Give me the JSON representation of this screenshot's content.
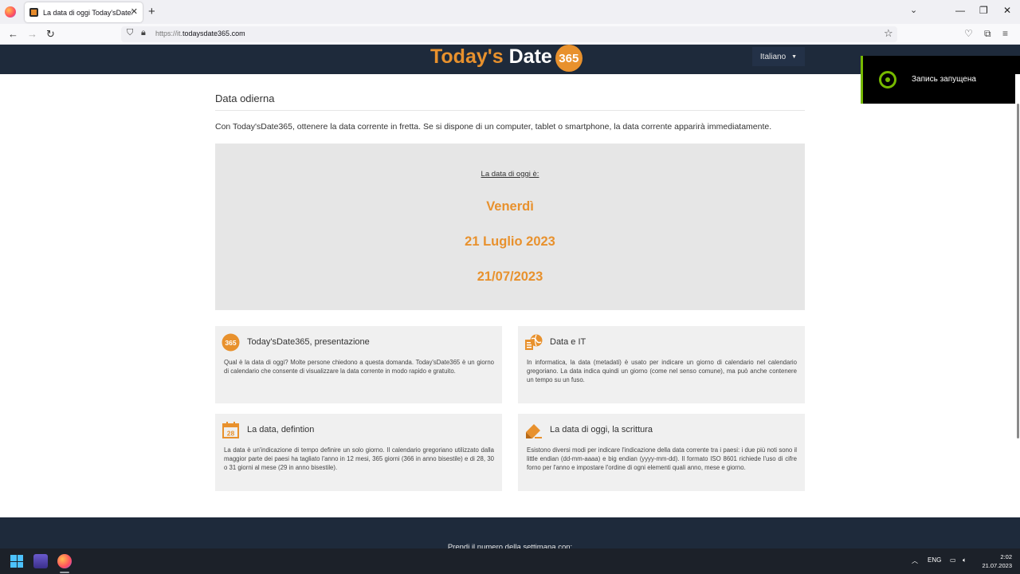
{
  "browser": {
    "tab_title": "La data di oggi Today'sDate365",
    "url_prefix": "https://it.",
    "url_domain": "todaysdate365.com"
  },
  "header": {
    "logo_today": "Today's",
    "logo_date": "Date",
    "logo_365": "365",
    "language": "Italiano"
  },
  "overlay": {
    "recording_text": "Запись запущена"
  },
  "main": {
    "title": "Data odierna",
    "intro": "Con Today'sDate365, ottenere la data corrente in fretta. Se si dispone di un computer, tablet o smartphone, la data corrente apparirà immediatamente.",
    "date_caption": "La data di oggi è:",
    "weekday": "Venerdì",
    "long_date": "21 Luglio 2023",
    "short_date": "21/07/2023"
  },
  "cards": [
    {
      "title": "Today'sDate365, presentazione",
      "icon_label": "365",
      "body": "Qual è la data di oggi? Molte persone chiedono a questa domanda. Today'sDate365 è un giorno di calendario che consente di visualizzare la data corrente in modo rapido e gratuito."
    },
    {
      "title": "Data e IT",
      "body": "In informatica, la data (metadati) è usato per indicare un giorno di calendario nel calendario gregoriano. La data indica quindi un giorno (come nel senso comune), ma può anche contenere un tempo su un fuso."
    },
    {
      "title": "La data, defintion",
      "icon_label": "28",
      "body": "La data è un'indicazione di tempo definire un solo giorno. Il calendario gregoriano utilizzato dalla maggior parte dei paesi ha tagliato l'anno in 12 mesi, 365 giorni (366 in anno bisestile) e di 28, 30 o 31 giorni al mese (29 in anno bisestile)."
    },
    {
      "title": "La data di oggi, la scrittura",
      "body": "Esistono diversi modi per indicare l'indicazione della data corrente tra i paesi: i due più noti sono il little endian (dd-mm-aaaa) e big endian (yyyy-mm-dd). Il formato ISO 8601 richiede l'uso di cifre forno per l'anno e impostare l'ordine di ogni elementi quali anno, mese e giorno."
    }
  ],
  "footer": {
    "text": "Prendi il numero della settimana con:"
  },
  "taskbar": {
    "language": "ENG",
    "time": "2:02",
    "date": "21.07.2023"
  },
  "colors": {
    "brand_orange": "#e8912d",
    "header_navy": "#1e2a3b",
    "nvidia_green": "#76b900"
  }
}
